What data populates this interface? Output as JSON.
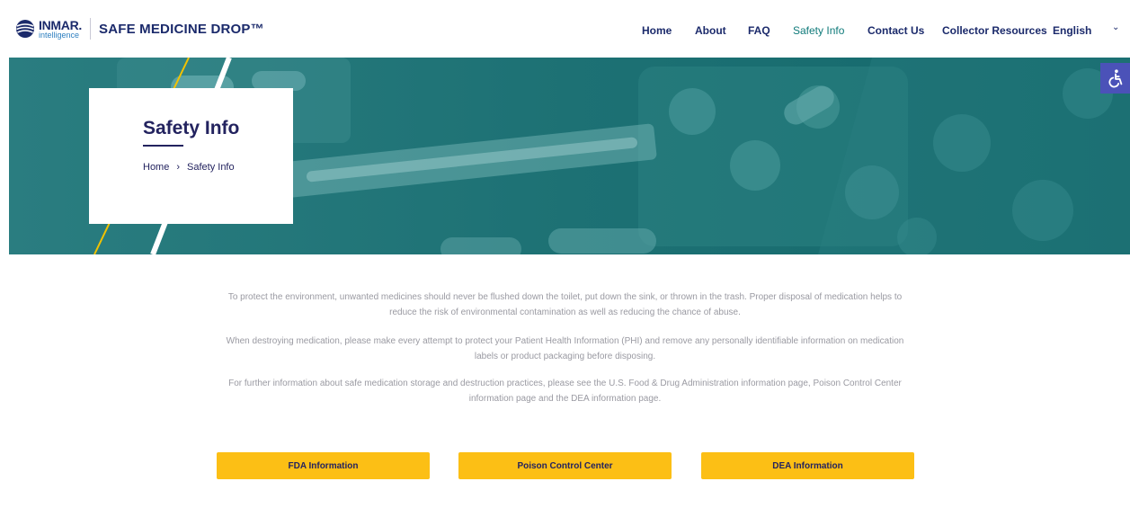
{
  "brand": {
    "company": "INMAR.",
    "company_sub": "intelligence",
    "site_name": "SAFE MEDICINE DROP™",
    "colors": {
      "navy": "#1b2a6b",
      "teal": "#1a6f72",
      "accent_yellow": "#fcbf15",
      "active_nav": "#0f7a7a"
    }
  },
  "nav": {
    "items": [
      {
        "label": "Home",
        "active": false
      },
      {
        "label": "About",
        "active": false
      },
      {
        "label": "FAQ",
        "active": false
      },
      {
        "label": "Safety Info",
        "active": true
      },
      {
        "label": "Contact Us",
        "active": false
      },
      {
        "label": "Collector Resources",
        "active": false
      }
    ],
    "language": "English",
    "language_icon": "chevron-down-icon"
  },
  "hero": {
    "title": "Safety Info",
    "breadcrumb": {
      "home": "Home",
      "separator": "›",
      "current": "Safety Info"
    }
  },
  "accessibility": {
    "icon": "accessibility-icon"
  },
  "content": {
    "paragraphs": [
      "To protect the environment, unwanted medicines should never be flushed down the toilet, put down the sink, or thrown in the trash. Proper disposal of medication helps to reduce the risk of environmental contamination as well as reducing the chance of abuse.",
      "When destroying medication, please make every attempt to protect your Patient Health Information (PHI) and remove any personally identifiable information on medication labels or product packaging before disposing.",
      "For further information about safe medication storage and destruction practices, please see the U.S. Food & Drug Administration information page, Poison Control Center information page and the DEA information page."
    ]
  },
  "buttons": {
    "fda": "FDA Information",
    "poison": "Poison Control Center",
    "dea": "DEA Information"
  }
}
